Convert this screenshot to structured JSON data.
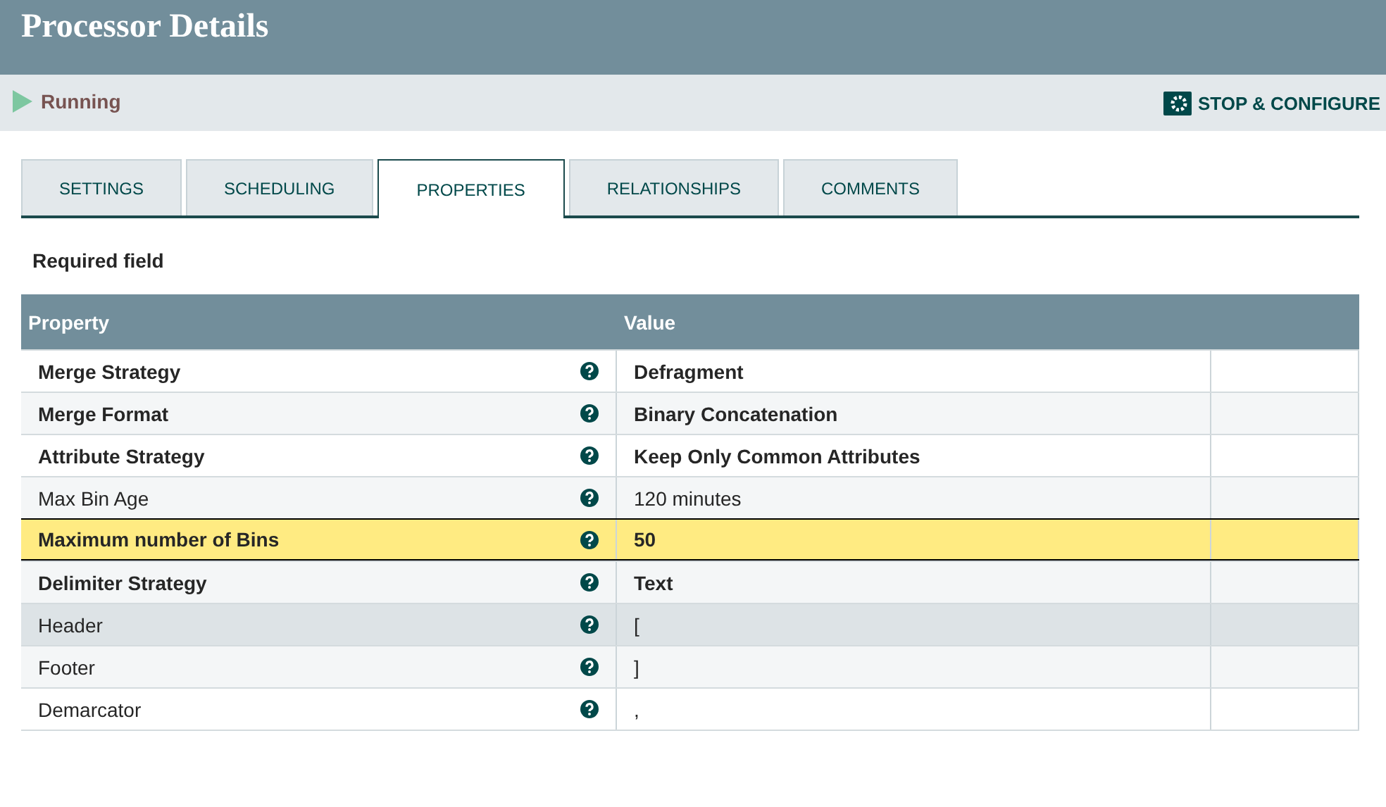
{
  "window": {
    "title": "Processor Details"
  },
  "status": {
    "state": "Running",
    "action": "STOP & CONFIGURE"
  },
  "tabs": [
    {
      "label": "SETTINGS",
      "selected": false
    },
    {
      "label": "SCHEDULING",
      "selected": false
    },
    {
      "label": "PROPERTIES",
      "selected": true
    },
    {
      "label": "RELATIONSHIPS",
      "selected": false
    },
    {
      "label": "COMMENTS",
      "selected": false
    }
  ],
  "legend": "Required field",
  "table": {
    "columns": [
      "Property",
      "Value"
    ],
    "rows": [
      {
        "property": "Merge Strategy",
        "value": "Defragment",
        "required": true,
        "selected": false,
        "hovered": false
      },
      {
        "property": "Merge Format",
        "value": "Binary Concatenation",
        "required": true,
        "selected": false,
        "hovered": false
      },
      {
        "property": "Attribute Strategy",
        "value": "Keep Only Common Attributes",
        "required": true,
        "selected": false,
        "hovered": false
      },
      {
        "property": "Max Bin Age",
        "value": "120 minutes",
        "required": false,
        "selected": false,
        "hovered": false
      },
      {
        "property": "Maximum number of Bins",
        "value": "50",
        "required": true,
        "selected": true,
        "hovered": false
      },
      {
        "property": "Delimiter Strategy",
        "value": "Text",
        "required": true,
        "selected": false,
        "hovered": false
      },
      {
        "property": "Header",
        "value": "[",
        "required": false,
        "selected": false,
        "hovered": true
      },
      {
        "property": "Footer",
        "value": "]",
        "required": false,
        "selected": false,
        "hovered": false
      },
      {
        "property": "Demarcator",
        "value": ",",
        "required": false,
        "selected": false,
        "hovered": false
      }
    ]
  }
}
